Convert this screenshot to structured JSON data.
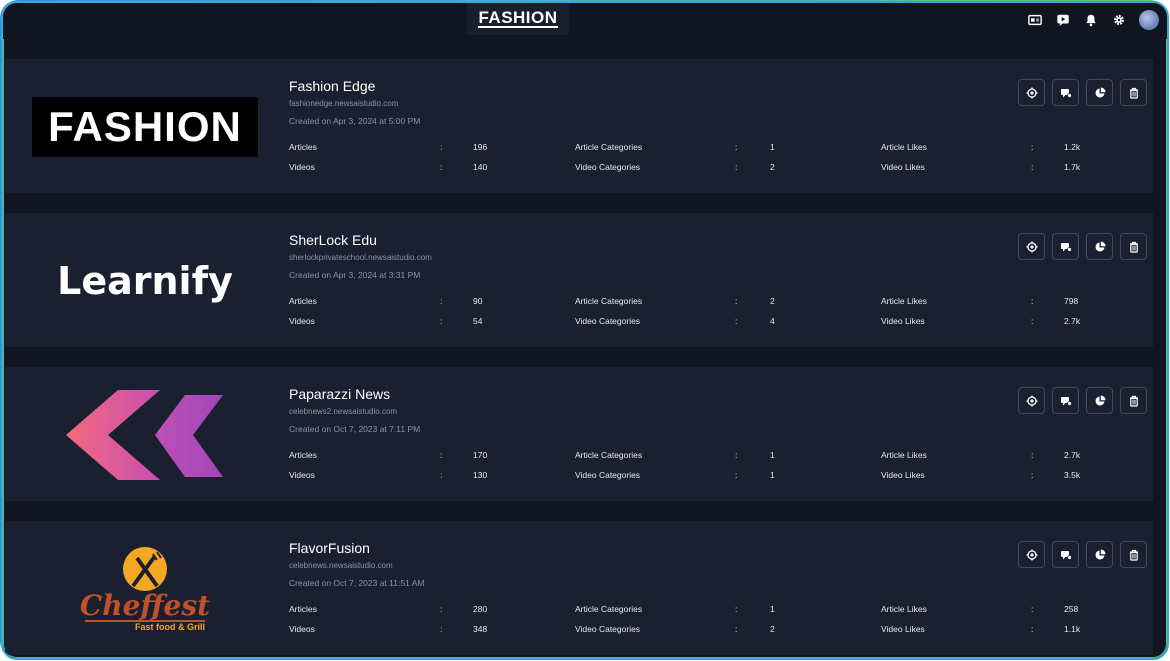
{
  "brand": "FASHION",
  "cards": [
    {
      "name": "Fashion Edge",
      "domain": "fashionedge.newsaistudio.com",
      "created": "Created on Apr 3, 2024 at 5:00 PM",
      "logo_text": "FASHION",
      "stats": {
        "articles": "196",
        "videos": "140",
        "article_categories": "1",
        "video_categories": "2",
        "article_likes": "1.2k",
        "video_likes": "1.7k"
      }
    },
    {
      "name": "SherLock Edu",
      "domain": "sherlockprivateschool.newsaistudio.com",
      "created": "Created on Apr 3, 2024 at 3:31 PM",
      "logo_text": "Learnify",
      "stats": {
        "articles": "90",
        "videos": "54",
        "article_categories": "2",
        "video_categories": "4",
        "article_likes": "798",
        "video_likes": "2.7k"
      }
    },
    {
      "name": "Paparazzi News",
      "domain": "celebnews2.newsaistudio.com",
      "created": "Created on Oct 7, 2023 at 7:11 PM",
      "logo_text": "",
      "stats": {
        "articles": "170",
        "videos": "130",
        "article_categories": "1",
        "video_categories": "1",
        "article_likes": "2.7k",
        "video_likes": "3.5k"
      }
    },
    {
      "name": "FlavorFusion",
      "domain": "celebnews.newsaistudio.com",
      "created": "Created on Oct 7, 2023 at 11:51 AM",
      "logo_text": "Cheffest",
      "logo_subtext": "Fast food & Grill",
      "stats": {
        "articles": "280",
        "videos": "348",
        "article_categories": "1",
        "video_categories": "2",
        "article_likes": "258",
        "video_likes": "1.1k"
      }
    }
  ],
  "labels": {
    "articles": "Articles",
    "videos": "Videos",
    "article_categories": "Article Categories",
    "video_categories": "Video Categories",
    "article_likes": "Article Likes",
    "video_likes": "Video Likes",
    "colon": ":"
  },
  "icons": {
    "top": [
      "switch-site-icon",
      "play-icon",
      "bell-icon",
      "gear-icon",
      "avatar"
    ],
    "card_actions": [
      "settings-target-icon",
      "chat-icon",
      "pie-chart-icon",
      "trash-icon"
    ]
  }
}
